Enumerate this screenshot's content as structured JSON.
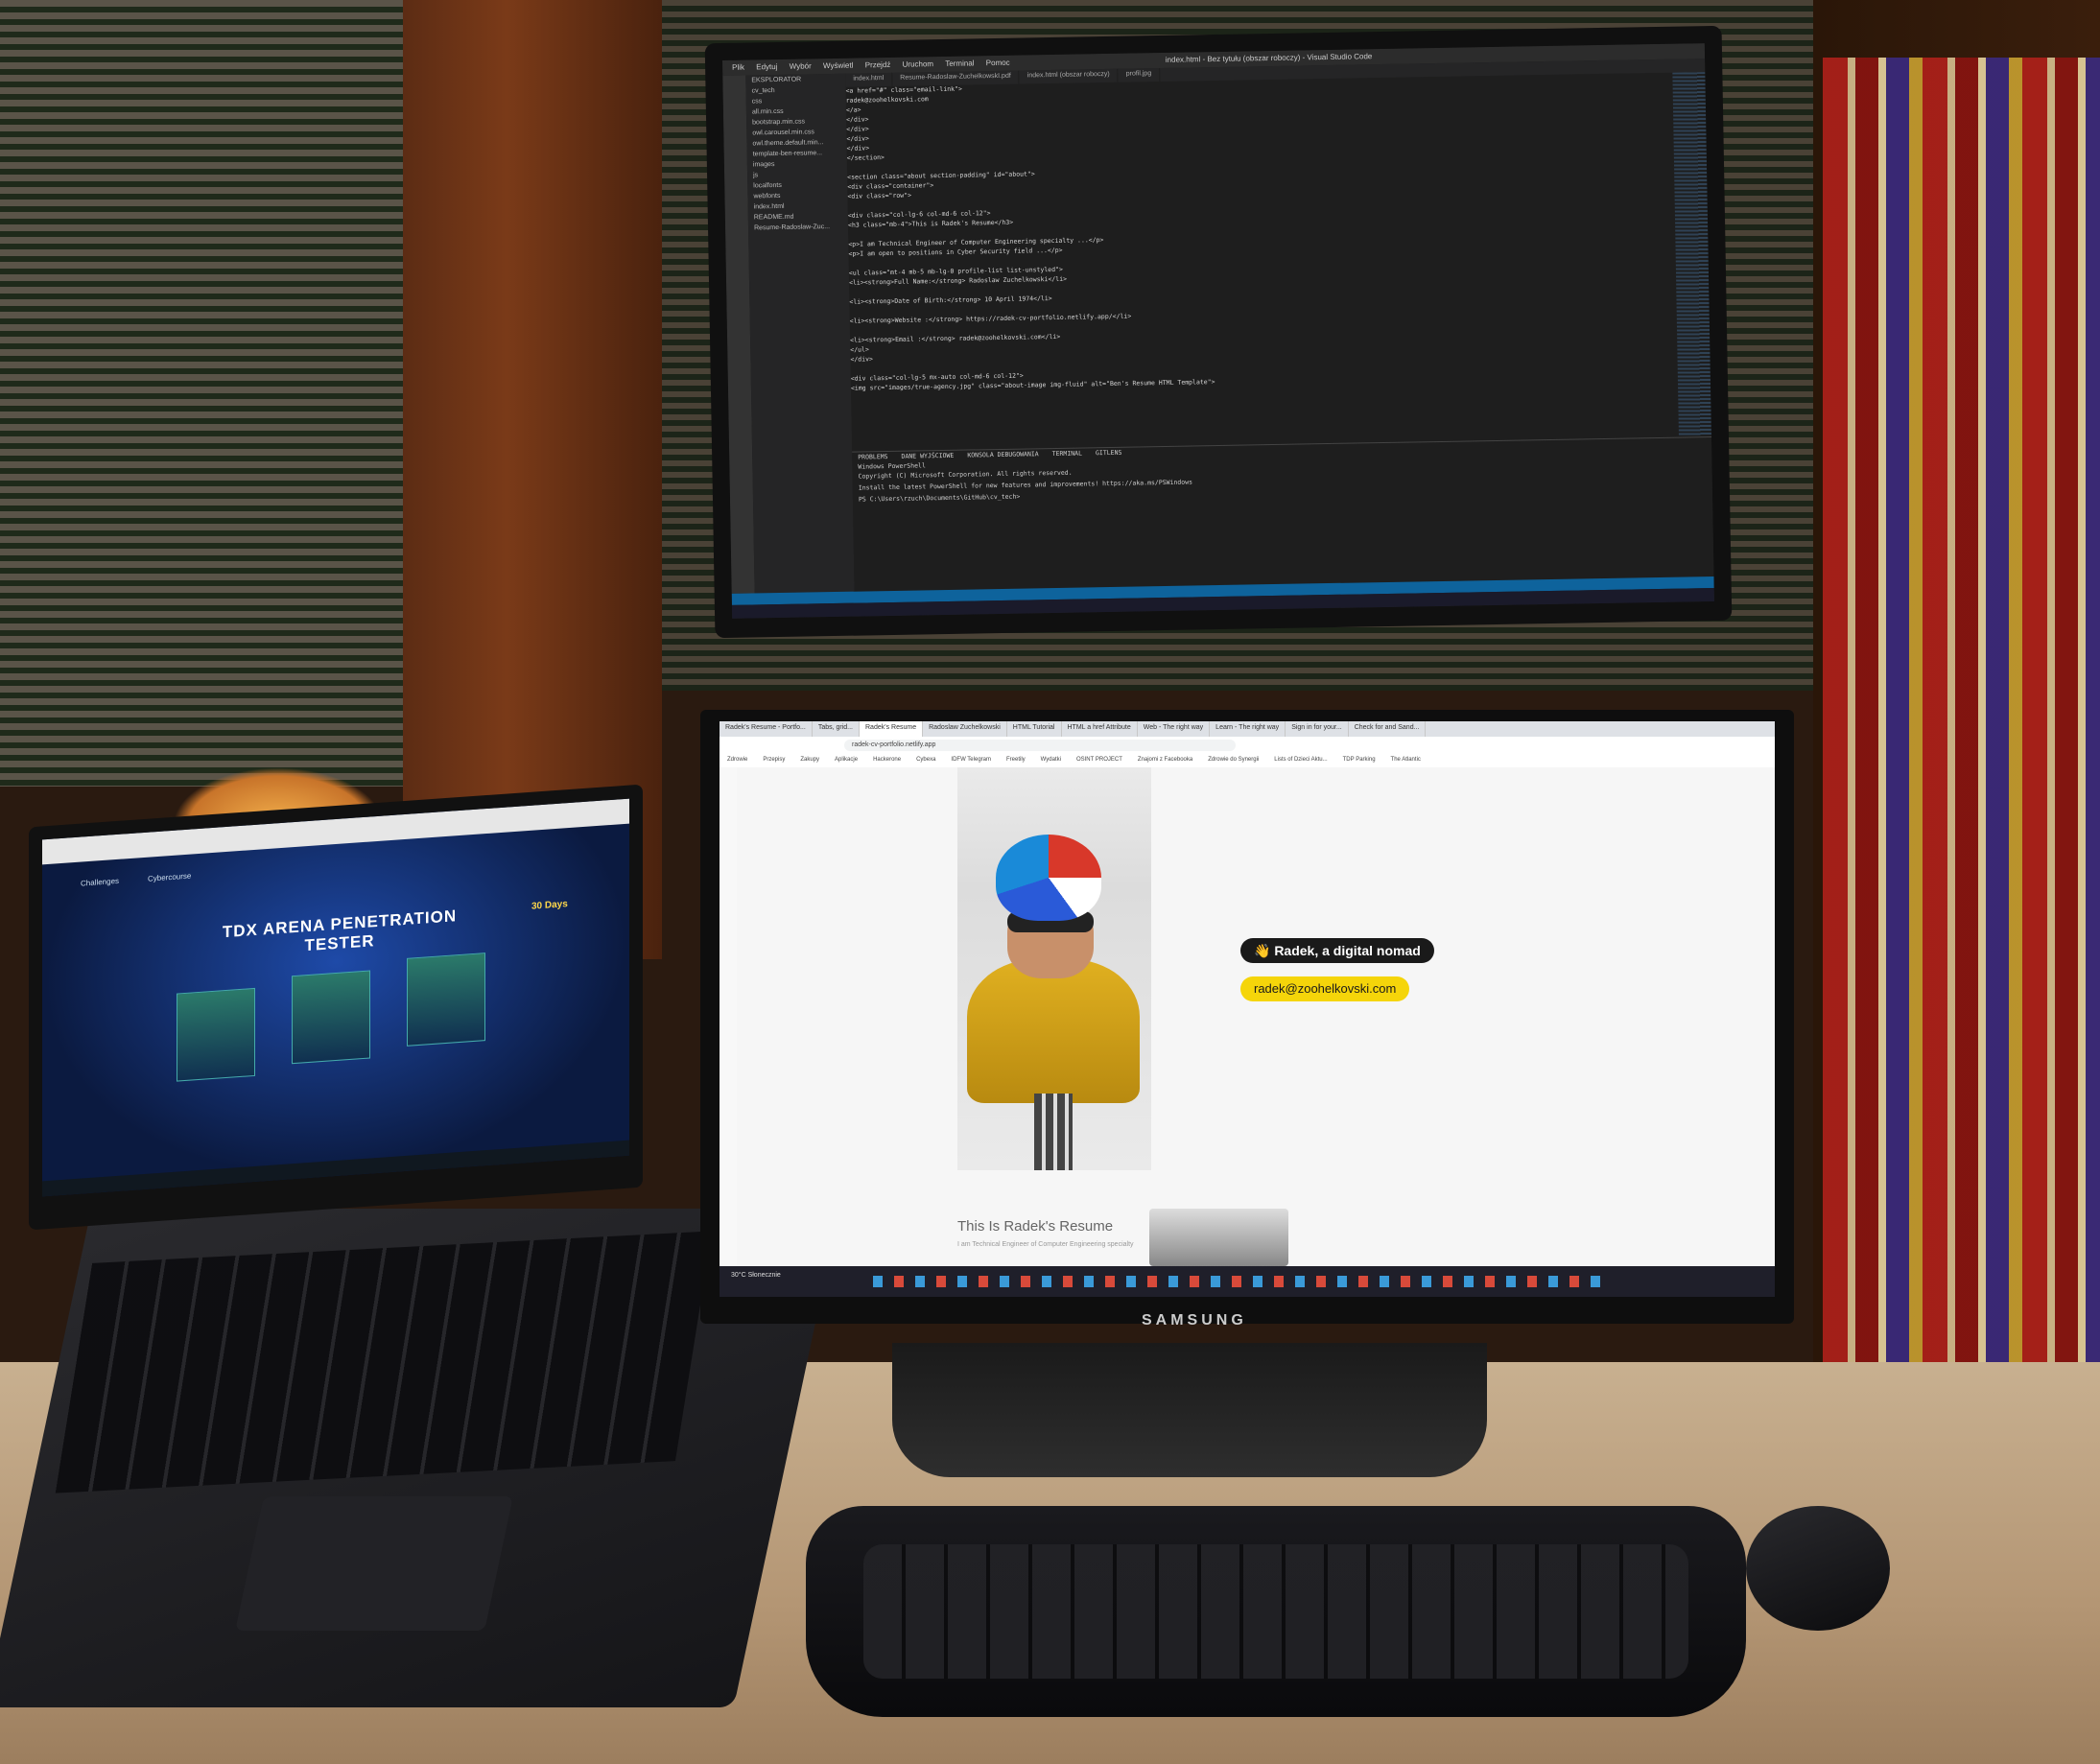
{
  "vscode": {
    "title": "index.html - Bez tytułu (obszar roboczy) - Visual Studio Code",
    "menu": [
      "Plik",
      "Edytuj",
      "Wybór",
      "Wyświetl",
      "Przejdź",
      "Uruchom",
      "Terminal",
      "Pomoc"
    ],
    "explorer_header": "EKSPLORATOR",
    "explorer_items": [
      "cv_tech",
      "css",
      "all.min.css",
      "bootstrap.min.css",
      "owl.carousel.min.css",
      "owl.theme.default.min...",
      "template-ben-resume...",
      "images",
      "js",
      "localfonts",
      "webfonts",
      "index.html",
      "README.md",
      "Resume-Radoslaw-Zuc..."
    ],
    "tabs": [
      "index.html",
      "Resume-Radoslaw-ZuchelkowskI.pdf",
      "index.html (obszar roboczy)",
      "profil.jpg"
    ],
    "code_lines": [
      "<a href=\"#\" class=\"email-link\">",
      "radek@zoohelkovski.com",
      "</a>",
      "</div>",
      "</div>",
      "</div>",
      "</div>",
      "</section>",
      "",
      "<section class=\"about section-padding\" id=\"about\">",
      "<div class=\"container\">",
      "<div class=\"row\">",
      "",
      "<div class=\"col-lg-6 col-md-6 col-12\">",
      "<h3 class=\"mb-4\">This is Radek's Resume</h3>",
      "",
      "<p>I am Technical Engineer of Computer Engineering specialty ...</p>",
      "<p>I am open to positions in Cyber Security field ...</p>",
      "",
      "<ul class=\"mt-4 mb-5 mb-lg-0 profile-list list-unstyled\">",
      "<li><strong>Full Name:</strong> Radoslaw Zuchelkowski</li>",
      "",
      "<li><strong>Date of Birth:</strong> 10 April 1974</li>",
      "",
      "<li><strong>Website :</strong> https://radek-cv-portfolio.netlify.app/</li>",
      "",
      "<li><strong>Email :</strong> radek@zoohelkovski.com</li>",
      "</ul>",
      "</div>",
      "",
      "<div class=\"col-lg-5 mx-auto col-md-6 col-12\">",
      "<img src=\"images/true-agency.jpg\" class=\"about-image img-fluid\" alt=\"Ben's Resume HTML Template\">"
    ],
    "panel_tabs": [
      "PROBLEMS",
      "DANE WYJŚCIOWE",
      "KONSOLA DEBUGOWANIA",
      "TERMINAL",
      "GITLENS"
    ],
    "terminal_lines": [
      "Windows PowerShell",
      "Copyright (C) Microsoft Corporation. All rights reserved.",
      "",
      "Install the latest PowerShell for new features and improvements! https://aka.ms/PSWindows",
      "",
      "PS C:\\Users\\rzuch\\Documents\\GitHub\\cv_tech> "
    ]
  },
  "laptop": {
    "title": "TDX ARENA PENETRATION TESTER",
    "badge": "30 Days",
    "nav": [
      "Challenges",
      "Cybercourse"
    ]
  },
  "browser": {
    "tabs": [
      "Radek's Resume - Portfo...",
      "Tabs, grid...",
      "Radek's Resume",
      "Radoslaw Zuchelkowski",
      "HTML Tutorial",
      "HTML a href Attribute",
      "Web - The right way",
      "Learn - The right way",
      "Sign in for your...",
      "Check for and Sand..."
    ],
    "url": "radek-cv-portfolio.netlify.app",
    "bookmarks": [
      "Zdrowie",
      "Przepisy",
      "Zakupy",
      "Aplikacje",
      "Hackerone",
      "Cybexa",
      "IDFW Telegram",
      "Freetily",
      "Wydatki",
      "OSINT PROJECT",
      "Znajomi z Facebooka",
      "Zdrowie do Synergii",
      "Lists of Dzieci Aktu...",
      "TDP Parking",
      "The Atlantic"
    ],
    "greeting": "👋 Radek, a digital nomad",
    "email": "radek@zoohelkovski.com",
    "resume_heading": "This Is Radek's Resume",
    "resume_sub": "I am Technical Engineer of Computer Engineering specialty",
    "weather": "30°C Słonecznie"
  },
  "monitor_brand": "SAMSUNG"
}
